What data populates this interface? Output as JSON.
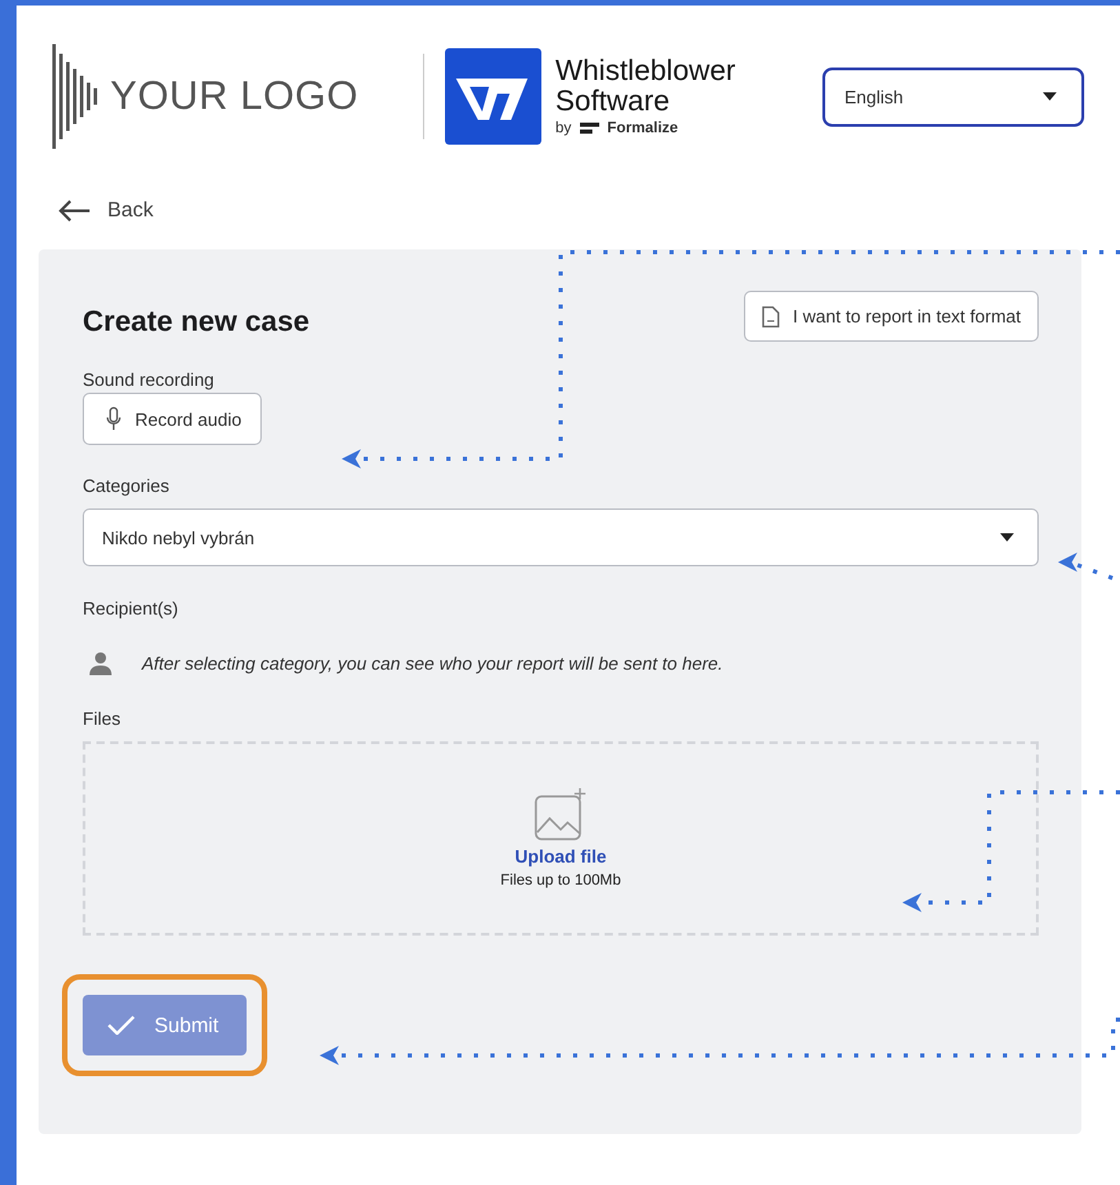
{
  "header": {
    "logo_text": "YOUR LOGO",
    "brand": {
      "name_line_1": "Whistleblower",
      "name_line_2": "Software",
      "by": "by",
      "maker": "Formalize"
    },
    "language_select": {
      "value": "English"
    }
  },
  "back_link": "Back",
  "form": {
    "title": "Create new case",
    "text_format_button": "I want to report in text format",
    "sound_recording": {
      "label": "Sound recording",
      "button": "Record audio"
    },
    "categories": {
      "label": "Categories",
      "value": "Nikdo nebyl vybrán"
    },
    "recipients": {
      "label": "Recipient(s)",
      "hint": "After selecting category, you can see who your report will be sent to here."
    },
    "files": {
      "label": "Files",
      "upload_link": "Upload file",
      "limit": "Files up to 100Mb"
    },
    "submit": {
      "label": "Submit",
      "disabled": true,
      "highlighted": true
    }
  }
}
